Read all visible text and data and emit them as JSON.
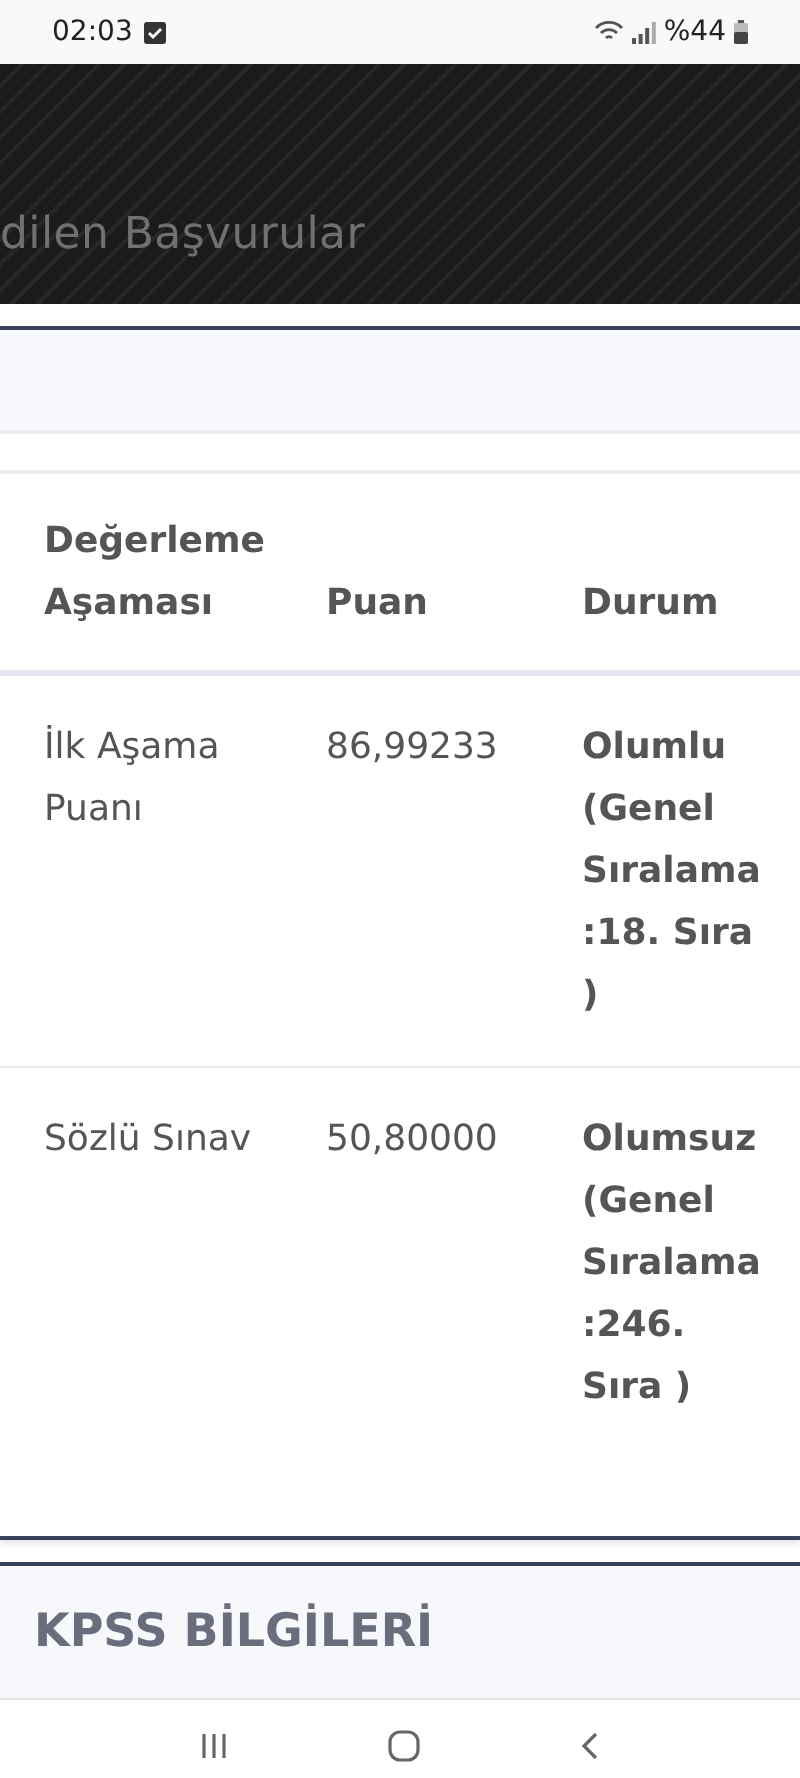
{
  "status_bar": {
    "time": "02:03",
    "battery": "%44"
  },
  "header": {
    "title": "dilen Başvurular"
  },
  "table": {
    "columns": [
      "Değerleme Aşaması",
      "Puan",
      "Durum"
    ],
    "rows": [
      {
        "stage": "İlk Aşama Puanı",
        "score": "86,99233",
        "status": "Olumlu (Genel Sıralama :18. Sıra )"
      },
      {
        "stage": "Sözlü Sınav",
        "score": "50,80000",
        "status": "Olumsuz (Genel Sıralama :246. Sıra )"
      }
    ]
  },
  "section": {
    "title": "KPSS BİLGİLERİ"
  }
}
